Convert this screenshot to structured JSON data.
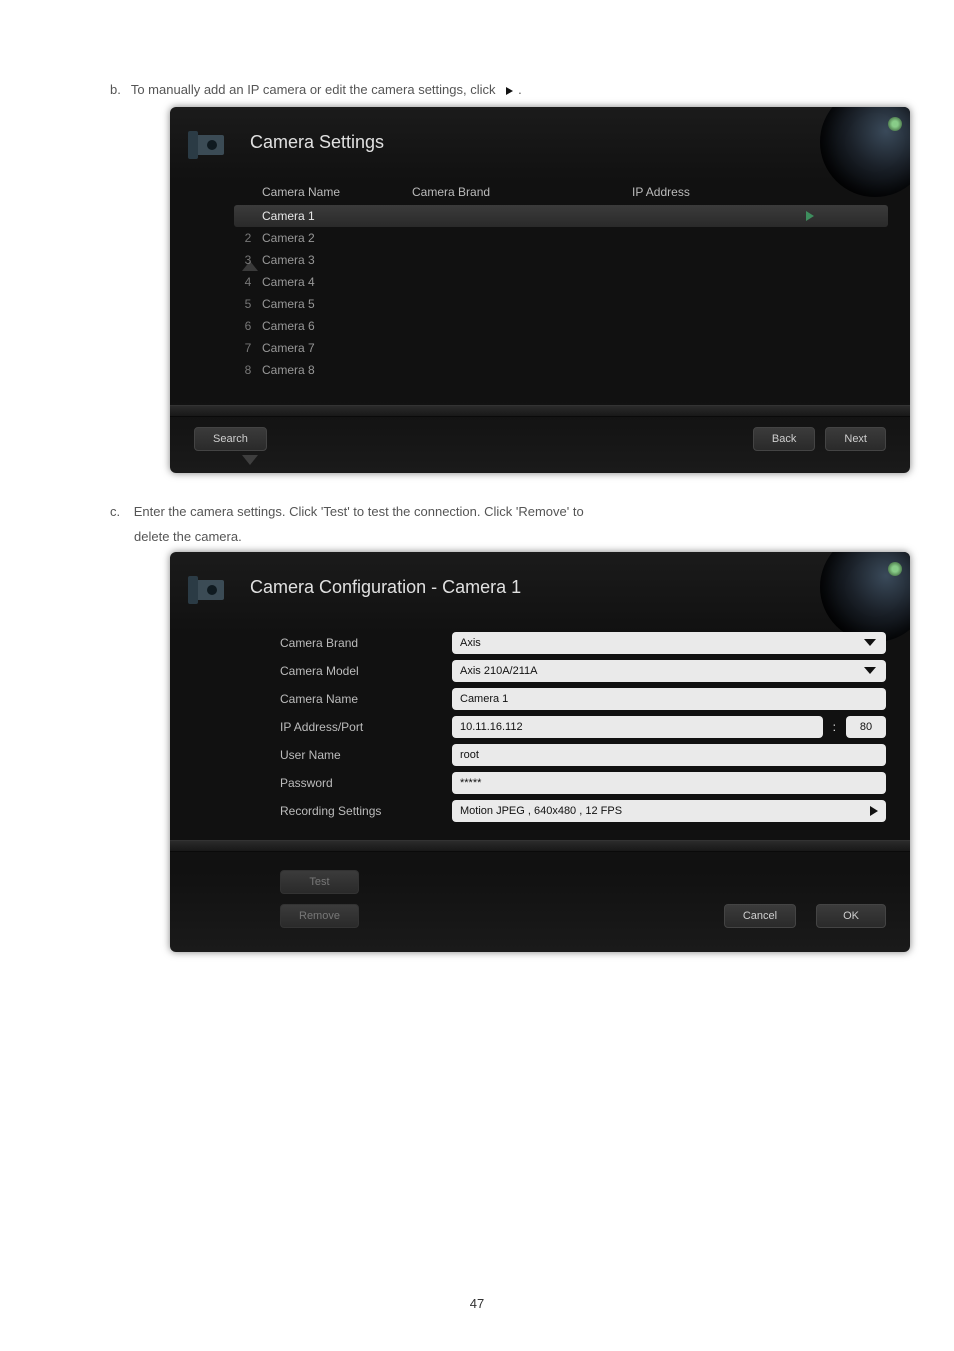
{
  "step_b": {
    "letter": "b.",
    "text": "To manually add an IP camera or edit the camera settings, click",
    "period": "."
  },
  "panel1": {
    "title": "Camera Settings",
    "columns": {
      "name": "Camera Name",
      "brand": "Camera Brand",
      "ip": "IP Address"
    },
    "rows": [
      {
        "num": "",
        "name": "Camera 1",
        "selected": true
      },
      {
        "num": "2",
        "name": "Camera 2"
      },
      {
        "num": "3",
        "name": "Camera 3"
      },
      {
        "num": "4",
        "name": "Camera 4"
      },
      {
        "num": "5",
        "name": "Camera 5"
      },
      {
        "num": "6",
        "name": "Camera 6"
      },
      {
        "num": "7",
        "name": "Camera 7"
      },
      {
        "num": "8",
        "name": "Camera 8"
      }
    ],
    "buttons": {
      "search": "Search",
      "back": "Back",
      "next": "Next"
    }
  },
  "step_c": {
    "letter": "c.",
    "line1": "Enter the camera settings.   Click 'Test' to test the connection.   Click 'Remove' to",
    "line2": "delete the camera."
  },
  "panel2": {
    "title": "Camera Configuration - Camera 1",
    "labels": {
      "brand": "Camera Brand",
      "model": "Camera Model",
      "name": "Camera Name",
      "ipport": "IP Address/Port",
      "user": "User Name",
      "pass": "Password",
      "rec": "Recording Settings"
    },
    "values": {
      "brand": "Axis",
      "model": "Axis 210A/211A",
      "name": "Camera 1",
      "ip": "10.11.16.112",
      "port": "80",
      "user": "root",
      "pass": "*****",
      "rec": "Motion JPEG , 640x480 , 12 FPS"
    },
    "buttons": {
      "test": "Test",
      "remove": "Remove",
      "cancel": "Cancel",
      "ok": "OK"
    }
  },
  "page_number": "47"
}
